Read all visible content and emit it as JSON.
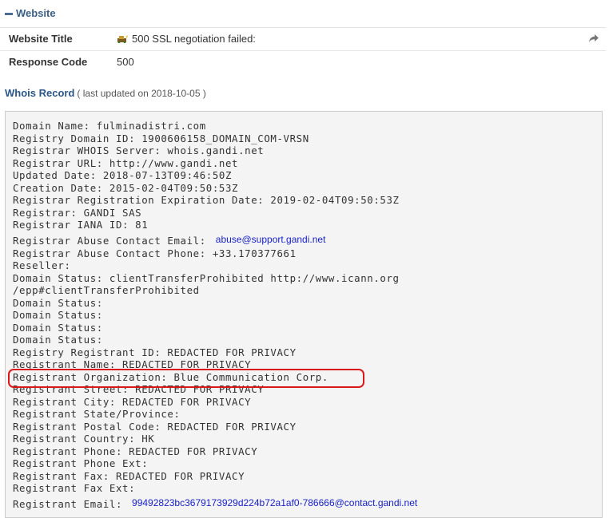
{
  "section": {
    "title": "Website",
    "collapse_icon": "minus-icon"
  },
  "website_title": {
    "label": "Website Title",
    "value": "500 SSL negotiation failed:",
    "icon": "website-favicon-icon",
    "action_icon": "share-icon"
  },
  "response_code": {
    "label": "Response Code",
    "value": "500"
  },
  "whois": {
    "title": "Whois Record",
    "subtitle": "( last updated on 2018-10-05 )",
    "lines": [
      {
        "text": "Domain Name: fulminadistri.com"
      },
      {
        "text": "Registry Domain ID: 1900606158_DOMAIN_COM-VRSN"
      },
      {
        "text": "Registrar WHOIS Server: whois.gandi.net"
      },
      {
        "text": "Registrar URL: http://www.gandi.net"
      },
      {
        "text": "Updated Date: 2018-07-13T09:46:50Z"
      },
      {
        "text": "Creation Date: 2015-02-04T09:50:53Z"
      },
      {
        "text": "Registrar Registration Expiration Date: 2019-02-04T09:50:53Z"
      },
      {
        "text": "Registrar: GANDI SAS"
      },
      {
        "text": "Registrar IANA ID: 81"
      },
      {
        "text": "Registrar Abuse Contact Email:",
        "email": "abuse@support.gandi.net"
      },
      {
        "text": "Registrar Abuse Contact Phone: +33.170377661"
      },
      {
        "text": "Reseller:"
      },
      {
        "text": "Domain Status: clientTransferProhibited http://www.icann.org"
      },
      {
        "text": "/epp#clientTransferProhibited"
      },
      {
        "text": "Domain Status:"
      },
      {
        "text": "Domain Status:"
      },
      {
        "text": "Domain Status:"
      },
      {
        "text": "Domain Status:"
      },
      {
        "text": "Registry Registrant ID: REDACTED FOR PRIVACY"
      },
      {
        "text": "Registrant Name: REDACTED FOR PRIVACY"
      },
      {
        "text": "Registrant Organization: Blue Communication Corp."
      },
      {
        "text": "Registrant Street: REDACTED FOR PRIVACY"
      },
      {
        "text": "Registrant City: REDACTED FOR PRIVACY"
      },
      {
        "text": "Registrant State/Province:"
      },
      {
        "text": "Registrant Postal Code: REDACTED FOR PRIVACY"
      },
      {
        "text": "Registrant Country: HK"
      },
      {
        "text": "Registrant Phone: REDACTED FOR PRIVACY"
      },
      {
        "text": "Registrant Phone Ext:"
      },
      {
        "text": "Registrant Fax: REDACTED FOR PRIVACY"
      },
      {
        "text": "Registrant Fax Ext:"
      },
      {
        "text": "Registrant Email:",
        "email": "99492823bc3679173929d224b72a1af0-786666@contact.gandi.net"
      }
    ]
  },
  "highlight_color": "#d91919",
  "link_color": "#1a23c8"
}
